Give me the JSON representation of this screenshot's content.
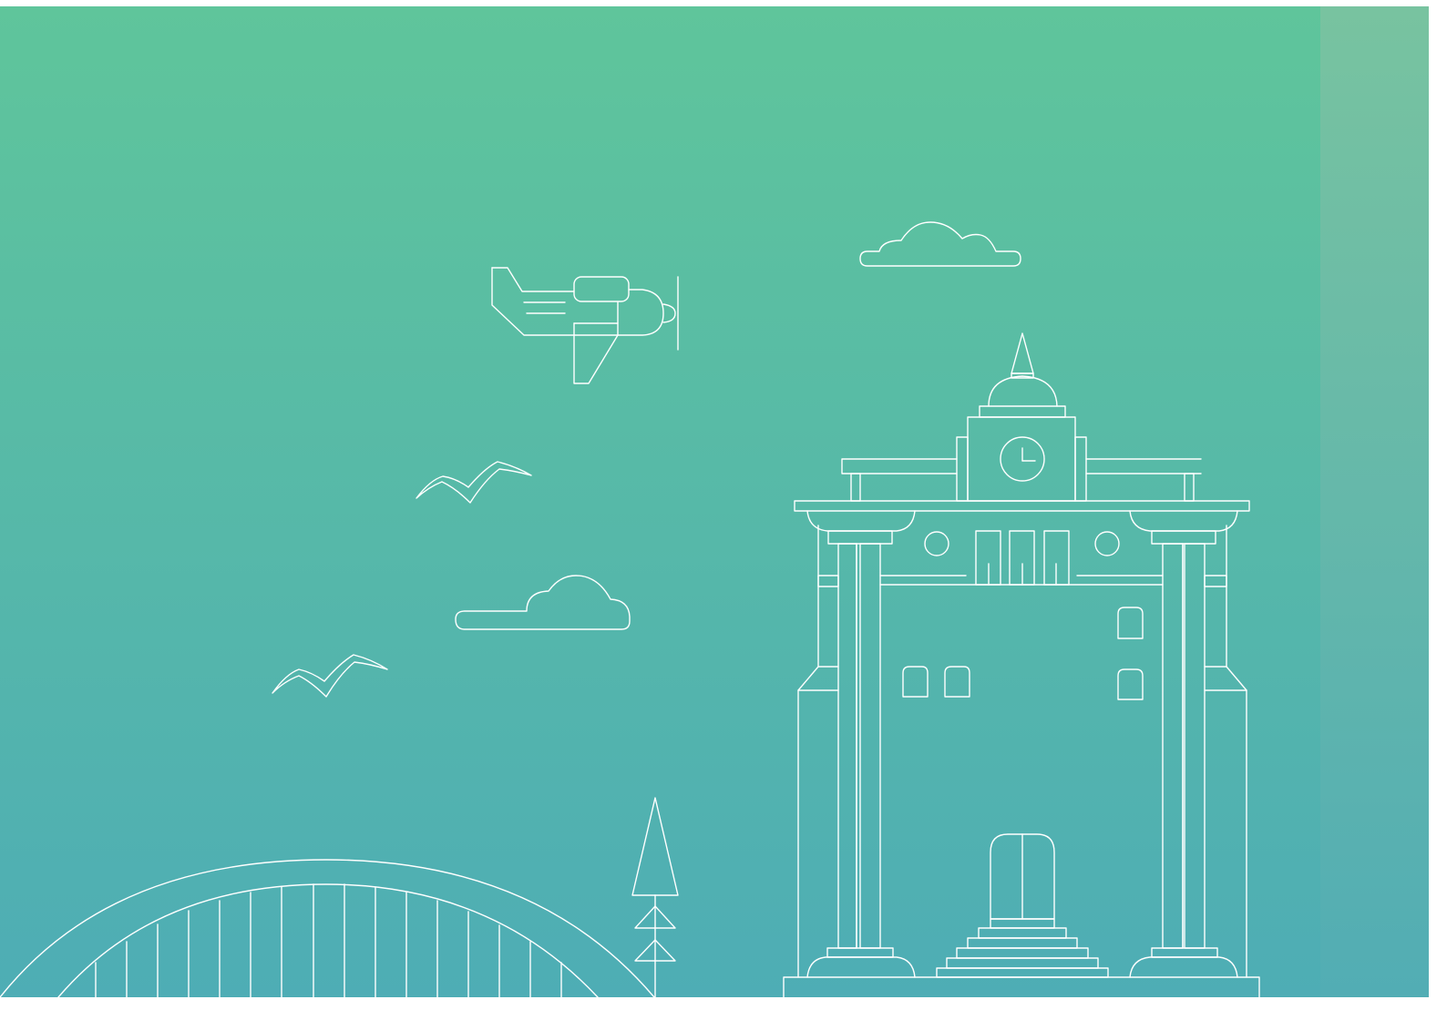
{
  "theme": {
    "gradient_top": "#5fc59b",
    "gradient_bottom": "#4eadb5",
    "strip_top": "#78c3a0",
    "strip_bottom": "#52adb4",
    "line_color": "#ffffff"
  },
  "illustration": {
    "scene": "line-art-cityscape",
    "elements": [
      {
        "name": "airplane",
        "icon": "propeller-plane-outline"
      },
      {
        "name": "cloud",
        "icon": "cloud-outline"
      },
      {
        "name": "bird",
        "icon": "seagull-outline"
      },
      {
        "name": "clock-tower-building",
        "icon": "columned-building-outline"
      },
      {
        "name": "arch-bridge",
        "icon": "arch-bridge-outline"
      },
      {
        "name": "tree",
        "icon": "pine-tree-outline"
      }
    ]
  }
}
